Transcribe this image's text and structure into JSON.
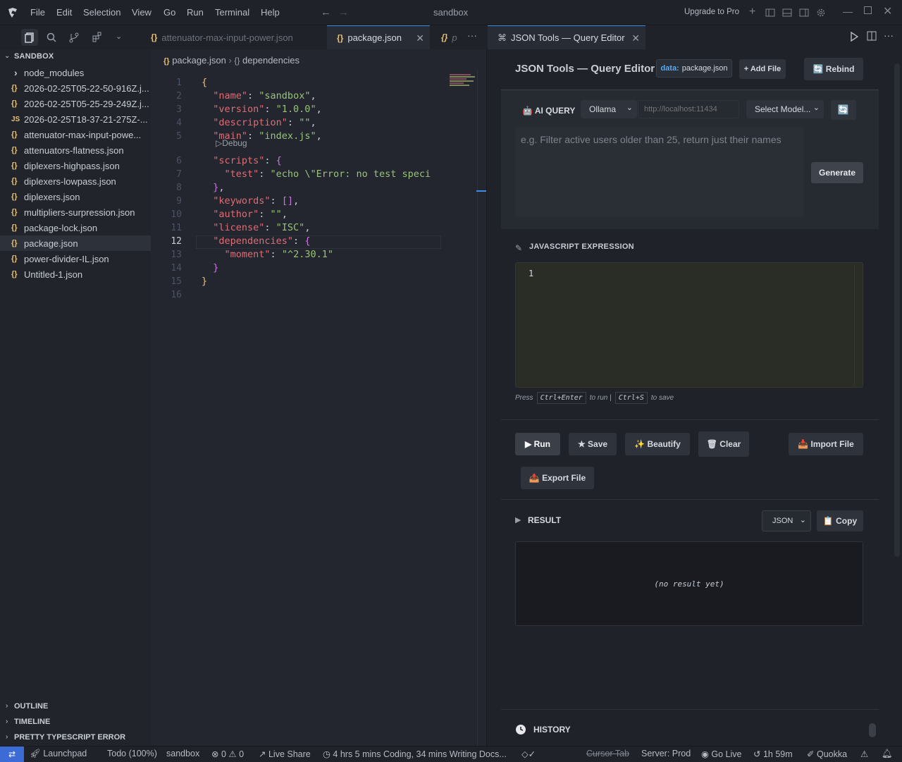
{
  "window": {
    "title": "sandbox",
    "menu": [
      "File",
      "Edit",
      "Selection",
      "View",
      "Go",
      "Run",
      "Terminal",
      "Help"
    ],
    "upgrade": "Upgrade to Pro"
  },
  "tabs": [
    {
      "label": "attenuator-max-input-power.json",
      "state": "inactive"
    },
    {
      "label": "package.json",
      "state": "active"
    },
    {
      "label": "p",
      "state": "inactive"
    },
    {
      "label": "JSON Tools — Query Editor",
      "state": "active"
    }
  ],
  "explorer": {
    "header": "SANDBOX",
    "items": [
      {
        "label": "node_modules",
        "icon": "chevron-right-icon"
      },
      {
        "label": "2026-02-25T05-22-50-916Z.j...",
        "icon": "json-icon"
      },
      {
        "label": "2026-02-25T05-25-29-249Z.j...",
        "icon": "json-icon"
      },
      {
        "label": "2026-02-25T18-37-21-275Z-...",
        "icon": "js-icon"
      },
      {
        "label": "attenuator-max-input-powe...",
        "icon": "json-icon"
      },
      {
        "label": "attenuators-flatness.json",
        "icon": "json-icon"
      },
      {
        "label": "diplexers-highpass.json",
        "icon": "json-icon"
      },
      {
        "label": "diplexers-lowpass.json",
        "icon": "json-icon"
      },
      {
        "label": "diplexers.json",
        "icon": "json-icon"
      },
      {
        "label": "multipliers-surpression.json",
        "icon": "json-icon"
      },
      {
        "label": "package-lock.json",
        "icon": "json-icon"
      },
      {
        "label": "package.json",
        "icon": "json-icon",
        "selected": true
      },
      {
        "label": "power-divider-IL.json",
        "icon": "json-icon"
      },
      {
        "label": "Untitled-1.json",
        "icon": "json-icon"
      }
    ],
    "sections": [
      "OUTLINE",
      "TIMELINE",
      "PRETTY TYPESCRIPT ERROR"
    ]
  },
  "editor": {
    "breadcrumb": [
      "package.json",
      "dependencies"
    ],
    "codelens": "Debug",
    "line_numbers": [
      "1",
      "2",
      "3",
      "4",
      "5",
      "6",
      "7",
      "8",
      "9",
      "10",
      "11",
      "12",
      "13",
      "14",
      "15",
      "16"
    ],
    "lines": [
      {
        "n": "1",
        "tokens": [
          {
            "t": "{",
            "c": "y"
          }
        ]
      },
      {
        "n": "2",
        "tokens": [
          {
            "t": "  \"name\"",
            "c": "k"
          },
          {
            "t": ": ",
            "c": "p"
          },
          {
            "t": "\"sandbox\"",
            "c": "s"
          },
          {
            "t": ",",
            "c": "p"
          }
        ]
      },
      {
        "n": "3",
        "tokens": [
          {
            "t": "  \"version\"",
            "c": "k"
          },
          {
            "t": ": ",
            "c": "p"
          },
          {
            "t": "\"1.0.0\"",
            "c": "s"
          },
          {
            "t": ",",
            "c": "p"
          }
        ]
      },
      {
        "n": "4",
        "tokens": [
          {
            "t": "  \"description\"",
            "c": "k"
          },
          {
            "t": ": ",
            "c": "p"
          },
          {
            "t": "\"\"",
            "c": "s"
          },
          {
            "t": ",",
            "c": "p"
          }
        ]
      },
      {
        "n": "5",
        "tokens": [
          {
            "t": "  \"main\"",
            "c": "k"
          },
          {
            "t": ": ",
            "c": "p"
          },
          {
            "t": "\"index.js\"",
            "c": "s"
          },
          {
            "t": ",",
            "c": "p"
          }
        ]
      },
      {
        "n": "6",
        "tokens": [
          {
            "t": "  \"scripts\"",
            "c": "k"
          },
          {
            "t": ": ",
            "c": "p"
          },
          {
            "t": "{",
            "c": "br"
          }
        ]
      },
      {
        "n": "7",
        "tokens": [
          {
            "t": "    \"test\"",
            "c": "k"
          },
          {
            "t": ": ",
            "c": "p"
          },
          {
            "t": "\"echo \\\"Error: no test speci",
            "c": "s"
          }
        ]
      },
      {
        "n": "8",
        "tokens": [
          {
            "t": "  }",
            "c": "br"
          },
          {
            "t": ",",
            "c": "p"
          }
        ]
      },
      {
        "n": "9",
        "tokens": [
          {
            "t": "  \"keywords\"",
            "c": "k"
          },
          {
            "t": ": ",
            "c": "p"
          },
          {
            "t": "[]",
            "c": "br"
          },
          {
            "t": ",",
            "c": "p"
          }
        ]
      },
      {
        "n": "10",
        "tokens": [
          {
            "t": "  \"author\"",
            "c": "k"
          },
          {
            "t": ": ",
            "c": "p"
          },
          {
            "t": "\"\"",
            "c": "s"
          },
          {
            "t": ",",
            "c": "p"
          }
        ]
      },
      {
        "n": "11",
        "tokens": [
          {
            "t": "  \"license\"",
            "c": "k"
          },
          {
            "t": ": ",
            "c": "p"
          },
          {
            "t": "\"ISC\"",
            "c": "s"
          },
          {
            "t": ",",
            "c": "p"
          }
        ]
      },
      {
        "n": "12",
        "tokens": [
          {
            "t": "  \"dependencies\"",
            "c": "k"
          },
          {
            "t": ": ",
            "c": "p"
          },
          {
            "t": "{",
            "c": "br"
          }
        ]
      },
      {
        "n": "13",
        "tokens": [
          {
            "t": "    \"moment\"",
            "c": "k"
          },
          {
            "t": ": ",
            "c": "p"
          },
          {
            "t": "\"^2.30.1\"",
            "c": "s"
          }
        ]
      },
      {
        "n": "14",
        "tokens": [
          {
            "t": "  }",
            "c": "br"
          }
        ]
      },
      {
        "n": "15",
        "tokens": [
          {
            "t": "}",
            "c": "y"
          }
        ]
      },
      {
        "n": "16",
        "tokens": []
      }
    ]
  },
  "query_editor": {
    "title": "JSON Tools — Query Editor",
    "data_prefix": "data:",
    "data_file": "package.json",
    "add_file": "+ Add File",
    "rebind": "🔄 Rebind",
    "ai_query_label": "🤖 AI QUERY",
    "provider": "Ollama",
    "endpoint_placeholder": "http://localhost:11434",
    "model": "Select Model...",
    "refresh": "🔄",
    "ai_placeholder": "e.g. Filter active users older than 25, return just their names",
    "generate": "Generate",
    "js_expression_label": "JAVASCRIPT EXPRESSION",
    "js_line_number": "1",
    "hint_press": "Press",
    "hint_run_key": "Ctrl+Enter",
    "hint_to_run": "to run |",
    "hint_save_key": "Ctrl+S",
    "hint_to_save": "to save",
    "run": "▶ Run",
    "save": "★ Save",
    "beautify": "✨ Beautify",
    "clear": "🗑 Clear",
    "import_file": "📥 Import File",
    "export_file": "📤 Export File",
    "result_label": "RESULT",
    "result_format": "JSON",
    "copy": "📋 Copy",
    "result_empty": "(no result yet)",
    "history_label": "HISTORY"
  },
  "statusbar": {
    "launchpad": "Launchpad",
    "todo": "Todo (100%)",
    "workspace": "sandbox",
    "errors": "0",
    "warnings": "0",
    "live_share": "Live Share",
    "coding_time": "4 hrs 5 mins Coding, 34 mins Writing Docs...",
    "cursor_tab": "Cursor Tab",
    "server": "Server: Prod",
    "go_live": "Go Live",
    "timer": "1h 59m",
    "quokka": "Quokka"
  },
  "colors": {
    "accent_blue": "#3c8ee8",
    "json_icon": "#e5c07b",
    "key_red": "#e06c75",
    "string_green": "#98c379",
    "bracket_purple": "#c678dd"
  }
}
